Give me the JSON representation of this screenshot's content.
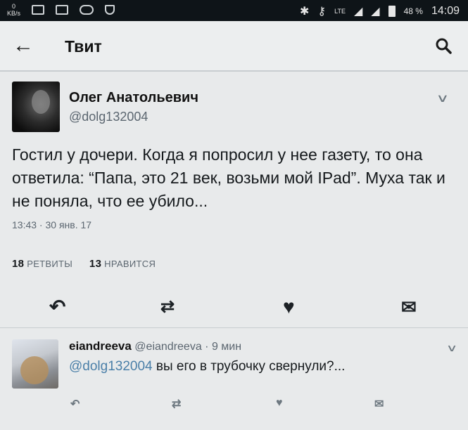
{
  "statusbar": {
    "speed": "0",
    "speed_unit": "KB/s",
    "network": "LTE",
    "battery": "48 %",
    "time": "14:09"
  },
  "header": {
    "title": "Твит",
    "back_icon": "arrow-left-icon",
    "search_icon": "search-icon"
  },
  "tweet": {
    "author_name": "Олег Анатольевич",
    "author_handle": "@dolg132004",
    "text": "Гостил у дочери. Когда я попросил у нее газету, то она ответила: “Папа, это 21 век, возьми мой IPad”. Муха так и не поняла, что ее убило...",
    "timestamp": "13:43 · 30 янв. 17",
    "retweets_count": "18",
    "retweets_label": "РЕТВИТЫ",
    "likes_count": "13",
    "likes_label": "НРАВИТСЯ"
  },
  "reply": {
    "author_name": "eiandreeva",
    "author_handle": "@eiandreeva",
    "time_ago": "9 мин",
    "mention": "@dolg132004",
    "text": "вы его в трубочку свернули?..."
  }
}
